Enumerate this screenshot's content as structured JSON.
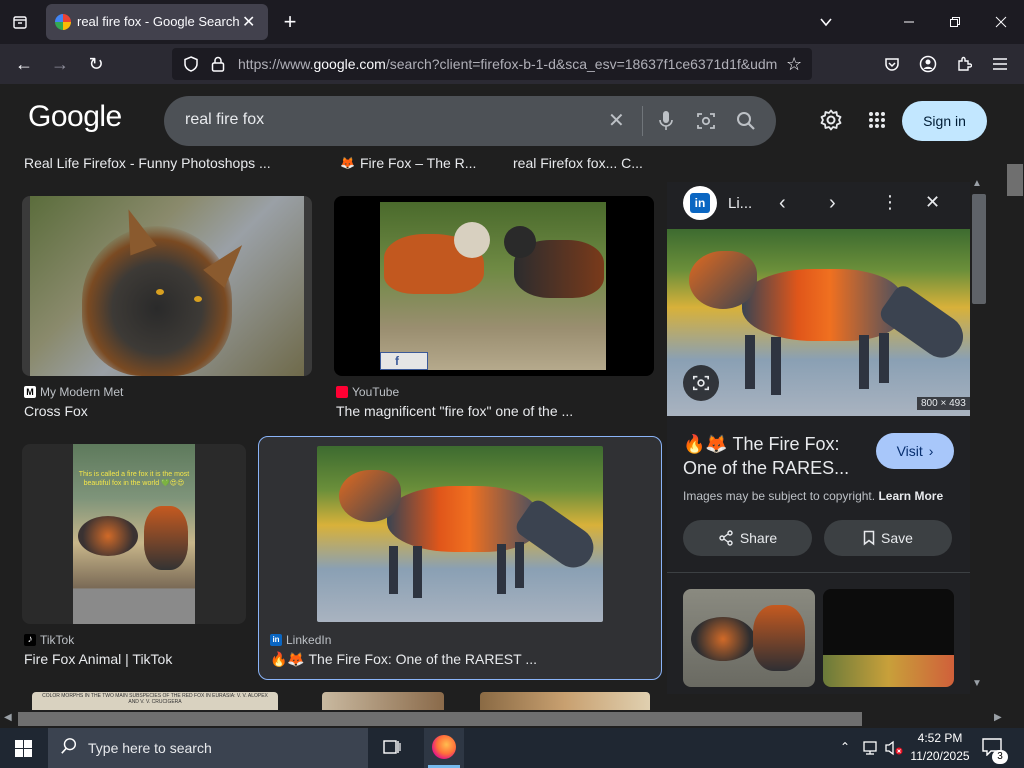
{
  "browser": {
    "tab_title": "real fire fox - Google Search",
    "url_prefix": "https://www.",
    "url_domain": "google.com",
    "url_rest": "/search?client=firefox-b-1-d&sca_esv=18637f1ce6371d1f&udm"
  },
  "google": {
    "logo": "Google",
    "query": "real fire fox",
    "sign_in": "Sign in"
  },
  "top_row": {
    "item1": "Real Life Firefox - Funny Photoshops ...",
    "item2": "Fire Fox – The R...",
    "item3": "real Firefox fox... C..."
  },
  "results": [
    {
      "source": "My Modern Met",
      "title": "Cross Fox"
    },
    {
      "source": "YouTube",
      "title": "The magnificent \"fire fox\" one of the ..."
    },
    {
      "source": "TikTok",
      "title": "Fire Fox Animal | TikTok",
      "overlay": "This is called a fire fox it is the most beautiful fox in the world 💚😍😍"
    },
    {
      "source": "LinkedIn",
      "title": "🔥🦊 The Fire Fox: One of the RAREST ..."
    }
  ],
  "panel": {
    "source_short": "Li...",
    "dimensions": "800 × 493",
    "title_line1": "🔥🦊 The Fire Fox:",
    "title_line2": "One of the RARES...",
    "visit": "Visit",
    "copyright": "Images may be subject to copyright.",
    "learn_more": "Learn More",
    "share": "Share",
    "save": "Save"
  },
  "bottom_row_caption": "COLOR MORPHS IN THE TWO MAIN SUBSPECIES OF THE RED FOX IN EURASIA: V. V. ALOPEX AND V. V. CRUCIGERA",
  "taskbar": {
    "search_placeholder": "Type here to search",
    "time": "4:52 PM",
    "date": "11/20/2025",
    "notification_count": "3"
  },
  "colors": {
    "accent_blue": "#a8c7fa",
    "signin_bg": "#c2e7ff",
    "selected_border": "#8ab4f8"
  }
}
